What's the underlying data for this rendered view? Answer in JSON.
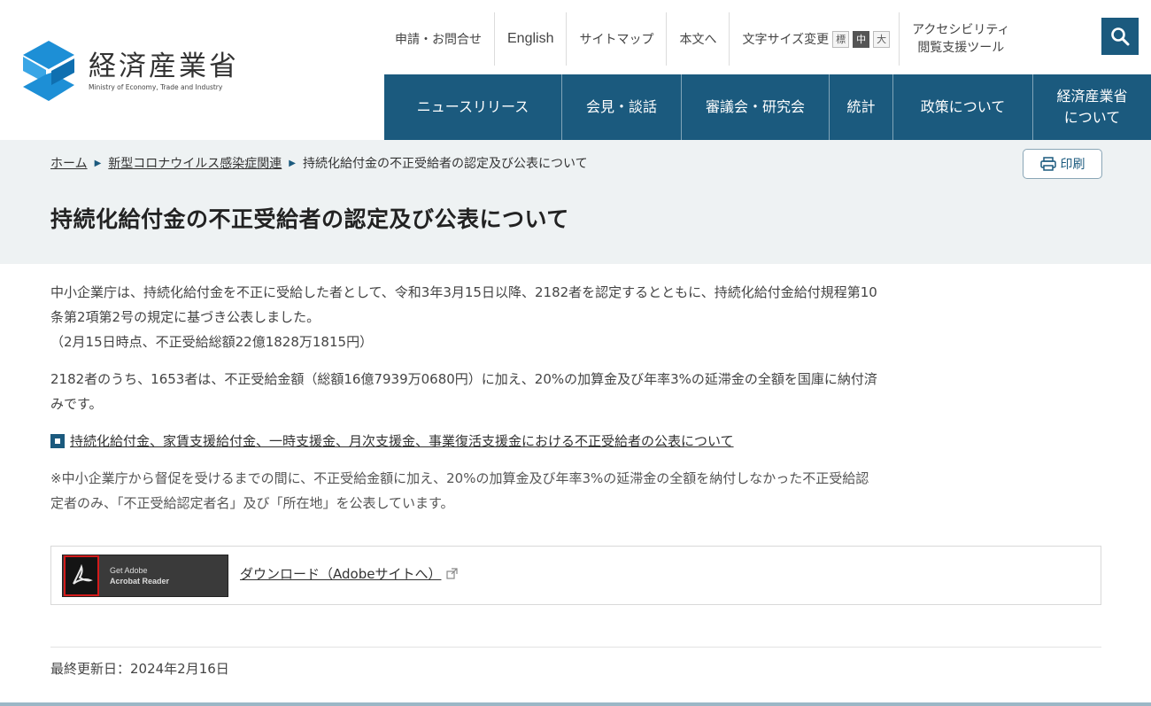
{
  "header": {
    "logo": {
      "name": "経済産業省",
      "name_en": "Ministry of Economy, Trade and Industry"
    },
    "utility_links": [
      {
        "label": "申請・お問合せ"
      },
      {
        "label": "English"
      },
      {
        "label": "サイトマップ"
      },
      {
        "label": "本文へ"
      }
    ],
    "font_size": {
      "label": "文字サイズ変更",
      "options": [
        "標",
        "中",
        "大"
      ],
      "selected": "中"
    },
    "accessibility": {
      "line1": "アクセシビリティ",
      "line2": "閲覧支援ツール"
    },
    "search_icon": "search-icon",
    "global_nav": [
      {
        "label": "ニュースリリース"
      },
      {
        "label": "会見・談話"
      },
      {
        "label": "審議会・研究会"
      },
      {
        "label": "統計"
      },
      {
        "label": "政策について"
      },
      {
        "label": "経済産業省\nについて"
      }
    ]
  },
  "breadcrumb": {
    "items": [
      "ホーム",
      "新型コロナウイルス感染症関連"
    ],
    "current": "持続化給付金の不正受給者の認定及び公表について"
  },
  "print_button": {
    "label": "印刷",
    "icon": "printer-icon"
  },
  "page_title": "持続化給付金の不正受給者の認定及び公表について",
  "content": {
    "para1_line1": "中小企業庁は、持続化給付金を不正に受給した者として、令和3年3月15日以降、2182者を認定するとともに、持続化給付金給付規程第10",
    "para1_line2": "条第2項第2号の規定に基づき公表しました。",
    "para1_line3": "（2月15日時点、不正受給総額22億1828万1815円）",
    "para2_line1": "2182者のうち、1653者は、不正受給金額（総額16億7939万0680円）に加え、20%の加算金及び年率3%の延滞金の全額を国庫に納付済",
    "para2_line2": "みです。",
    "link_label": "持続化給付金、家賃支援給付金、一時支援金、月次支援金、事業復活支援金における不正受給者の公表について",
    "note_line1": "※中小企業庁から督促を受けるまでの間に、不正受給金額に加え、20%の加算金及び年率3%の延滞金の全額を納付しなかった不正受給認",
    "note_line2": "定者のみ、「不正受給認定者名」及び「所在地」を公表しています。"
  },
  "adobe": {
    "badge_line1": "Get Adobe",
    "badge_line2": "Acrobat Reader",
    "download_label": "ダウンロード（Adobeサイトへ）"
  },
  "last_updated": "最終更新日：2024年2月16日",
  "colors": {
    "brand": "#1b5a7e",
    "band": "#eef2f3",
    "logo_blue": "#1d8fd6"
  }
}
